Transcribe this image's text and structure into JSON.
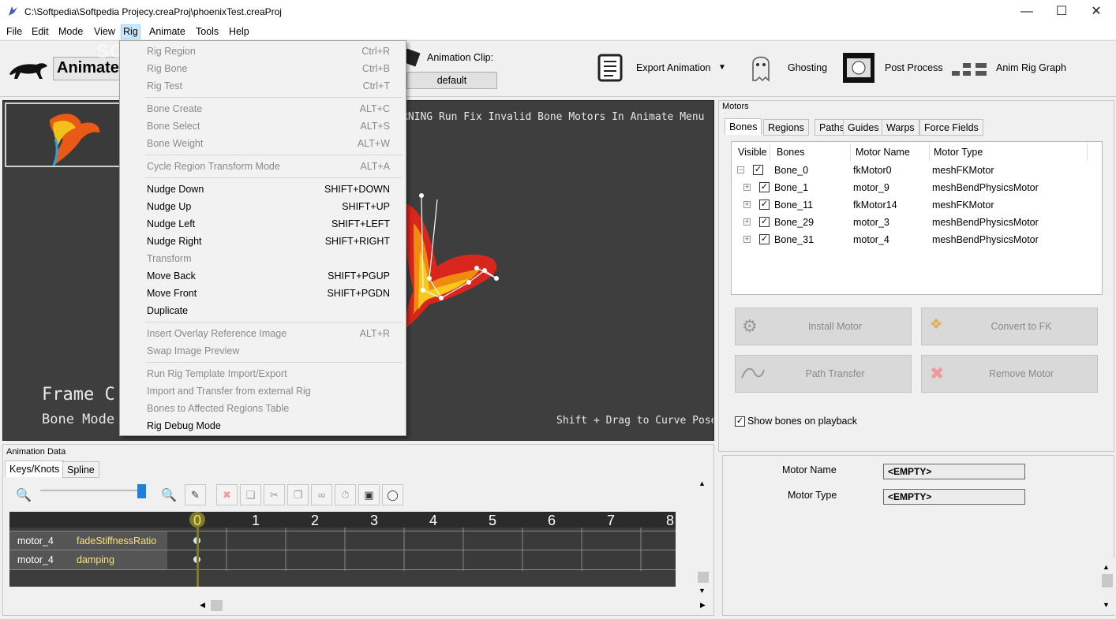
{
  "window": {
    "title": "C:\\Softpedia\\Softpedia Projecy.creaProj\\phoenixTest.creaProj"
  },
  "menubar": [
    "File",
    "Edit",
    "Mode",
    "View",
    "Rig",
    "Animate",
    "Tools",
    "Help"
  ],
  "toolbar": {
    "mode": "Animate",
    "clip_label": "Animation Clip:",
    "clip_value": "default",
    "export": "Export Animation",
    "ghosting": "Ghosting",
    "post": "Post Process",
    "graph": "Anim Rig Graph",
    "watermark": "SOFTPEDIA"
  },
  "viewport": {
    "warning": "RNING Run Fix Invalid Bone Motors In Animate Menu",
    "frame": "Frame C",
    "mode": "Bone Mode",
    "hint": "Shift + Drag to Curve Pose"
  },
  "rig_menu": [
    {
      "label": "Rig Region",
      "shortcut": "Ctrl+R",
      "disabled": true
    },
    {
      "label": "Rig Bone",
      "shortcut": "Ctrl+B",
      "disabled": true
    },
    {
      "label": "Rig Test",
      "shortcut": "Ctrl+T",
      "disabled": true
    },
    {
      "sep": true
    },
    {
      "label": "Bone Create",
      "shortcut": "ALT+C",
      "disabled": true
    },
    {
      "label": "Bone Select",
      "shortcut": "ALT+S",
      "disabled": true
    },
    {
      "label": "Bone Weight",
      "shortcut": "ALT+W",
      "disabled": true
    },
    {
      "sep": true
    },
    {
      "label": "Cycle Region Transform Mode",
      "shortcut": "ALT+A",
      "disabled": true
    },
    {
      "sep": true
    },
    {
      "label": "Nudge Down",
      "shortcut": "SHIFT+DOWN",
      "disabled": false
    },
    {
      "label": "Nudge Up",
      "shortcut": "SHIFT+UP",
      "disabled": false
    },
    {
      "label": "Nudge Left",
      "shortcut": "SHIFT+LEFT",
      "disabled": false
    },
    {
      "label": "Nudge Right",
      "shortcut": "SHIFT+RIGHT",
      "disabled": false
    },
    {
      "label": "Transform",
      "shortcut": "",
      "disabled": true
    },
    {
      "label": "Move Back",
      "shortcut": "SHIFT+PGUP",
      "disabled": false
    },
    {
      "label": "Move Front",
      "shortcut": "SHIFT+PGDN",
      "disabled": false
    },
    {
      "label": "Duplicate",
      "shortcut": "",
      "disabled": false
    },
    {
      "sep": true
    },
    {
      "label": "Insert Overlay Reference Image",
      "shortcut": "ALT+R",
      "disabled": true
    },
    {
      "label": "Swap Image Preview",
      "shortcut": "",
      "disabled": true
    },
    {
      "sep": true
    },
    {
      "label": "Run Rig Template Import/Export",
      "shortcut": "",
      "disabled": true
    },
    {
      "label": "Import and Transfer from external Rig",
      "shortcut": "",
      "disabled": true
    },
    {
      "label": "Bones to Affected Regions Table",
      "shortcut": "",
      "disabled": true
    },
    {
      "label": "Rig Debug Mode",
      "shortcut": "",
      "disabled": false
    }
  ],
  "anim": {
    "header": "Animation Data",
    "tabs": [
      "Keys/Knots",
      "Spline"
    ],
    "ticks": [
      "0",
      "1",
      "2",
      "3",
      "4",
      "5",
      "6",
      "7",
      "8"
    ],
    "rows": [
      {
        "motor": "motor_4",
        "prop": "fadeStiffnessRatio"
      },
      {
        "motor": "motor_4",
        "prop": "damping"
      }
    ]
  },
  "motors": {
    "header": "Motors",
    "tabs": [
      "Bones",
      "Regions",
      "Paths",
      "Guides",
      "Warps",
      "Force Fields"
    ],
    "columns": [
      "Visible",
      "Bones",
      "Motor Name",
      "Motor Type"
    ],
    "rows": [
      {
        "bone": "Bone_0",
        "motor": "fkMotor0",
        "type": "meshFKMotor",
        "exp": "−"
      },
      {
        "bone": "Bone_1",
        "motor": "motor_9",
        "type": "meshBendPhysicsMotor",
        "exp": "+"
      },
      {
        "bone": "Bone_11",
        "motor": "fkMotor14",
        "type": "meshFKMotor",
        "exp": "+"
      },
      {
        "bone": "Bone_29",
        "motor": "motor_3",
        "type": "meshBendPhysicsMotor",
        "exp": "+"
      },
      {
        "bone": "Bone_31",
        "motor": "motor_4",
        "type": "meshBendPhysicsMotor",
        "exp": "+"
      }
    ],
    "buttons": {
      "install": "Install Motor",
      "convert": "Convert to FK",
      "path": "Path Transfer",
      "remove": "Remove Motor"
    },
    "show_bones": "Show bones on playback"
  },
  "props": {
    "name_label": "Motor Name",
    "name_value": "<EMPTY>",
    "type_label": "Motor Type",
    "type_value": "<EMPTY>"
  }
}
